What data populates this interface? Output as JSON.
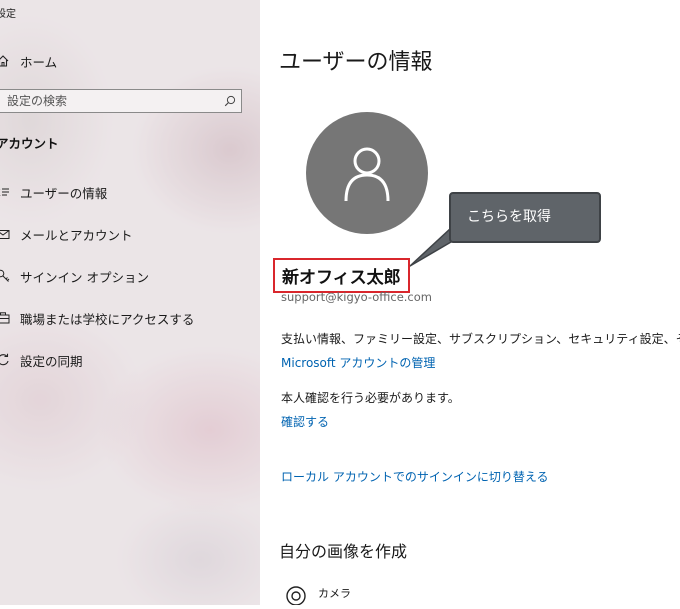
{
  "app": {
    "title": "設定"
  },
  "sidebar": {
    "home_label": "ホーム",
    "search_placeholder": "設定の検索",
    "section_title": "アカウント",
    "items": [
      {
        "label": "ユーザーの情報",
        "icon": "user-info-icon"
      },
      {
        "label": "メールとアカウント",
        "icon": "mail-icon"
      },
      {
        "label": "サインイン オプション",
        "icon": "key-icon"
      },
      {
        "label": "職場または学校にアクセスする",
        "icon": "briefcase-icon"
      },
      {
        "label": "設定の同期",
        "icon": "sync-icon"
      }
    ]
  },
  "main": {
    "title": "ユーザーの情報",
    "user_name": "新オフィス太郎",
    "user_email": "support@kigyo-office.com",
    "callout_text": "こちらを取得",
    "subscription_info": "支払い情報、ファミリー設定、サブスクリプション、セキュリティ設定、その他",
    "manage_account_link": "Microsoft アカウントの管理",
    "verify_text": "本人確認を行う必要があります。",
    "verify_link": "確認する",
    "local_account_link": "ローカル アカウントでのサインインに切り替える",
    "create_picture_heading": "自分の画像を作成",
    "camera_label": "カメラ"
  },
  "colors": {
    "link": "#0063b1",
    "avatar_bg": "#767676",
    "highlight_border": "#d9262c",
    "callout_bg": "#5f6469"
  }
}
